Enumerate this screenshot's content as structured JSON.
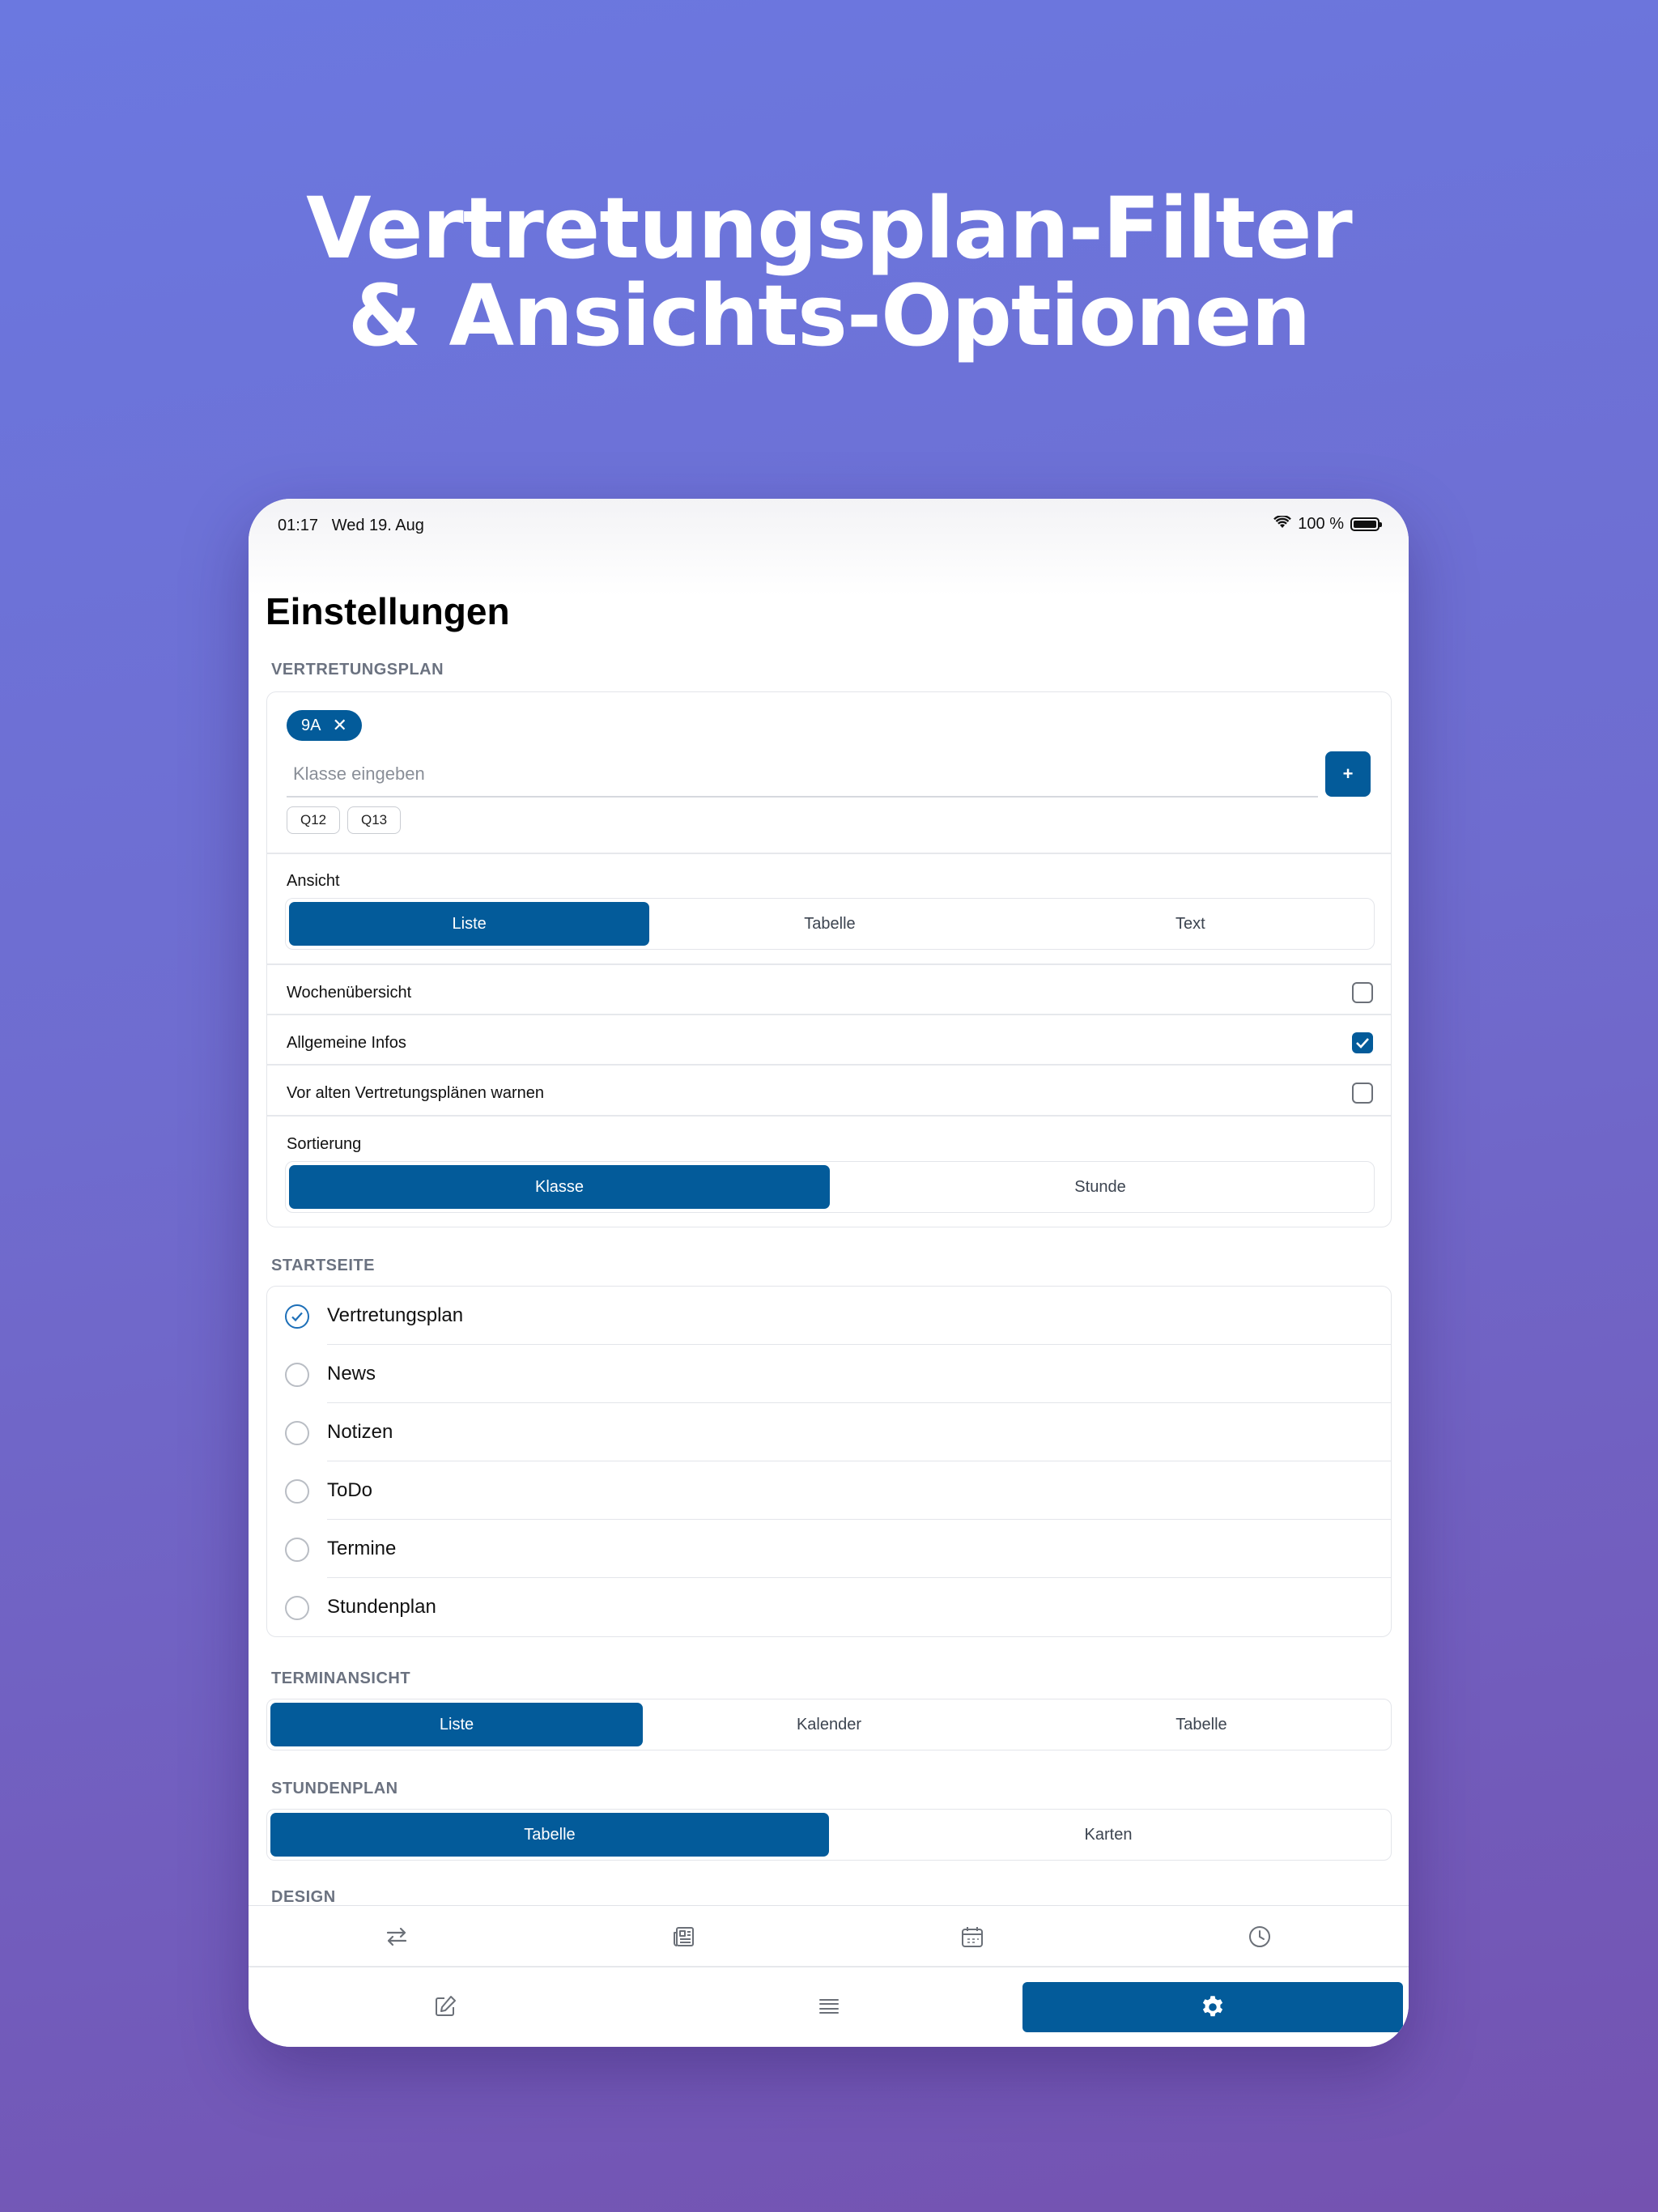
{
  "headline": {
    "line1": "Vertretungsplan-Filter",
    "line2": "& Ansichts-Optionen"
  },
  "status": {
    "time": "01:17",
    "date": "Wed 19. Aug",
    "battery": "100 %"
  },
  "page_title": "Einstellungen",
  "vertretungsplan": {
    "section_label": "VERTRETUNGSPLAN",
    "selected_class_chip": "9A",
    "class_input_placeholder": "Klasse eingeben",
    "add_button_label": "+",
    "suggestions": [
      "Q12",
      "Q13"
    ],
    "view_label": "Ansicht",
    "view_options": [
      "Liste",
      "Tabelle",
      "Text"
    ],
    "view_selected": "Liste",
    "toggles": [
      {
        "label": "Wochenübersicht",
        "checked": false
      },
      {
        "label": "Allgemeine Infos",
        "checked": true
      },
      {
        "label": "Vor alten Vertretungsplänen warnen",
        "checked": false
      }
    ],
    "sort_label": "Sortierung",
    "sort_options": [
      "Klasse",
      "Stunde"
    ],
    "sort_selected": "Klasse"
  },
  "startseite": {
    "section_label": "STARTSEITE",
    "options": [
      "Vertretungsplan",
      "News",
      "Notizen",
      "ToDo",
      "Termine",
      "Stundenplan"
    ],
    "selected": "Vertretungsplan"
  },
  "terminansicht": {
    "section_label": "TERMINANSICHT",
    "options": [
      "Liste",
      "Kalender",
      "Tabelle"
    ],
    "selected": "Liste"
  },
  "stundenplan": {
    "section_label": "STUNDENPLAN",
    "options": [
      "Tabelle",
      "Karten"
    ],
    "selected": "Tabelle"
  },
  "design": {
    "section_label": "DESIGN"
  },
  "tab_bar": {
    "row1": [
      "swap-arrows-icon",
      "newspaper-icon",
      "calendar-icon",
      "clock-icon"
    ],
    "row2": [
      "edit-icon",
      "list-icon",
      "gear-icon"
    ],
    "active": "gear-icon"
  },
  "colors": {
    "accent": "#035b9a",
    "background_top": "#6b78e0",
    "background_bottom": "#7452b0"
  }
}
